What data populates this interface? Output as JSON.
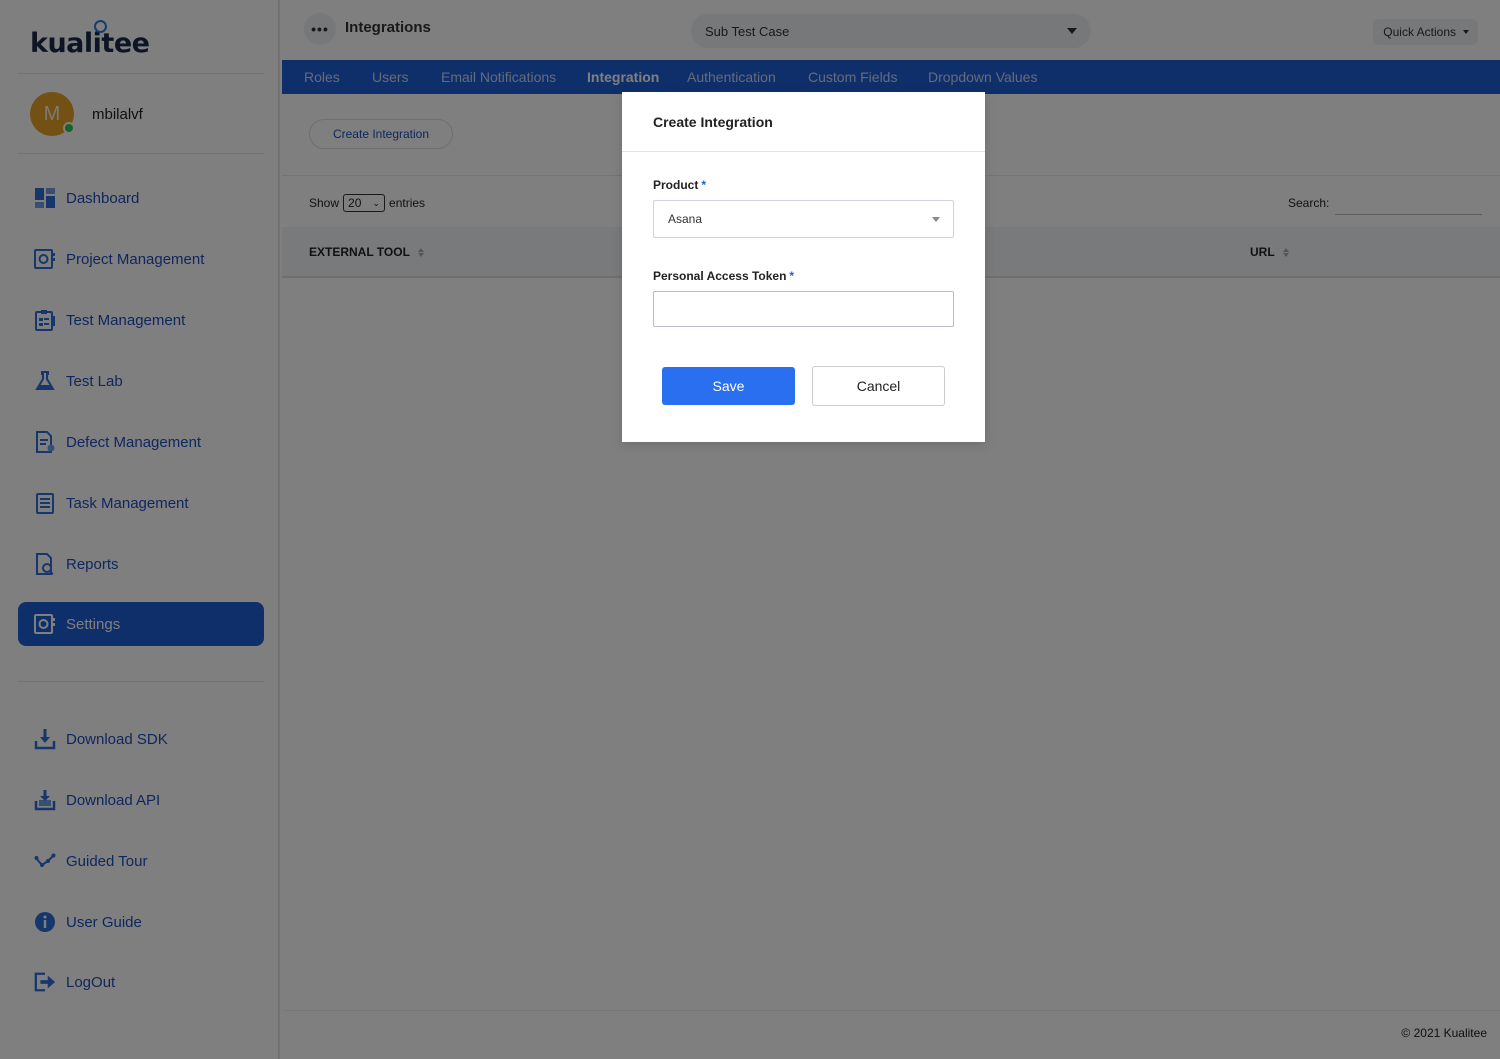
{
  "app": {
    "logo_text_a": "kual",
    "logo_text_i": "i",
    "logo_text_b": "tee"
  },
  "user": {
    "initial": "M",
    "name": "mbilalvf"
  },
  "sidebar": {
    "items": [
      {
        "label": "Dashboard",
        "icon": "dashboard-icon",
        "active": false
      },
      {
        "label": "Project Management",
        "icon": "project-management-icon",
        "active": false
      },
      {
        "label": "Test Management",
        "icon": "test-management-icon",
        "active": false
      },
      {
        "label": "Test Lab",
        "icon": "flask-icon",
        "active": false
      },
      {
        "label": "Defect Management",
        "icon": "defect-icon",
        "active": false
      },
      {
        "label": "Task Management",
        "icon": "task-icon",
        "active": false
      },
      {
        "label": "Reports",
        "icon": "reports-icon",
        "active": false
      },
      {
        "label": "Settings",
        "icon": "settings-icon",
        "active": true
      }
    ],
    "bottom_items": [
      {
        "label": "Download SDK",
        "icon": "download-sdk-icon"
      },
      {
        "label": "Download API",
        "icon": "download-api-icon"
      },
      {
        "label": "Guided Tour",
        "icon": "guided-tour-icon"
      },
      {
        "label": "User Guide",
        "icon": "info-icon"
      },
      {
        "label": "LogOut",
        "icon": "logout-icon"
      }
    ]
  },
  "header": {
    "menu_glyph": "•••",
    "title": "Integrations",
    "project_select": "Sub Test Case",
    "quick_actions": "Quick Actions"
  },
  "tabs": [
    {
      "label": "Roles",
      "active": false
    },
    {
      "label": "Users",
      "active": false
    },
    {
      "label": "Email Notifications",
      "active": false
    },
    {
      "label": "Integration",
      "active": true
    },
    {
      "label": "Authentication",
      "active": false
    },
    {
      "label": "Custom Fields",
      "active": false
    },
    {
      "label": "Dropdown Values",
      "active": false
    }
  ],
  "main": {
    "create_button": "Create Integration",
    "show_label": "Show",
    "entries_value": "20",
    "entries_label": "entries",
    "search_label": "Search:",
    "columns": [
      "EXTERNAL TOOL",
      "URL"
    ]
  },
  "footer": {
    "copyright": "© 2021 Kualitee"
  },
  "modal": {
    "title": "Create Integration",
    "product_label": "Product",
    "product_value": "Asana",
    "token_label": "Personal Access Token",
    "token_value": "",
    "required_mark": "*",
    "save_label": "Save",
    "cancel_label": "Cancel"
  },
  "colors": {
    "primary": "#1f5fd6",
    "save_button": "#2a6ff0",
    "avatar": "#e6a126",
    "online": "#31c44b"
  }
}
